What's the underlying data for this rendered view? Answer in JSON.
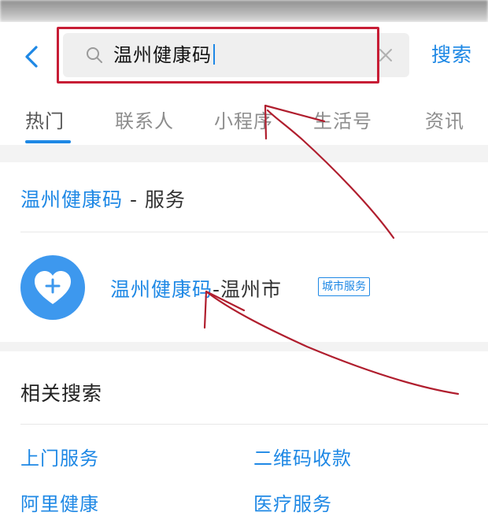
{
  "search": {
    "query": "温州健康码",
    "submit_label": "搜索"
  },
  "tabs": [
    {
      "label": "热门",
      "active": true
    },
    {
      "label": "联系人"
    },
    {
      "label": "小程序"
    },
    {
      "label": "生活号"
    },
    {
      "label": "资讯"
    }
  ],
  "service_section": {
    "title_highlight": "温州健康码",
    "title_rest": " - 服务",
    "app": {
      "name_highlight": "温州健康码",
      "name_rest": "-温州市",
      "badge": "城市服务"
    }
  },
  "related": {
    "title": "相关搜索",
    "items": [
      "上门服务",
      "二维码收款",
      "阿里健康",
      "医疗服务"
    ]
  },
  "colors": {
    "accent": "#1e88e5",
    "annotation": "#c71d35",
    "app_icon": "#3d98ee"
  }
}
